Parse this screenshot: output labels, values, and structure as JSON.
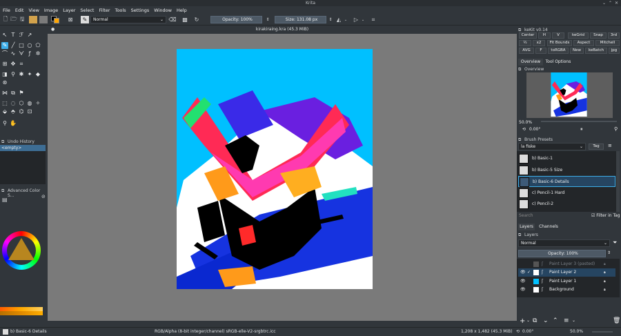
{
  "window": {
    "title": "Krita"
  },
  "menu": [
    "File",
    "Edit",
    "View",
    "Image",
    "Layer",
    "Select",
    "Filter",
    "Tools",
    "Settings",
    "Window",
    "Help"
  ],
  "toolbar": {
    "blend_mode": "Normal",
    "opacity": "Opacity: 100%",
    "size": "Size: 131.08 px"
  },
  "document": {
    "tab_title": "kirakiraing.kra (45.3 MiB)"
  },
  "left_dock": {
    "undo_history_title": "Undo History",
    "undo_item": "<empty>",
    "advanced_color_title": "Advanced Color S..."
  },
  "right_dock": {
    "kekit_title": "keKit v0.14",
    "kekit_row1": [
      "Center",
      "H",
      "V",
      "keGrid",
      "Snap",
      "3rd"
    ],
    "kekit_row2": [
      "½",
      "x2",
      "Fit Bounds",
      "Aspect",
      "Mitchell"
    ],
    "kekit_row3": [
      "AVG",
      "F",
      "toRGBA",
      "New",
      "keBatch",
      "jpg"
    ],
    "tabs": [
      "Overview",
      "Tool Options"
    ],
    "overview_title": "Overview",
    "zoom": "50.0%",
    "rotation": "0.00°",
    "brush_presets_title": "Brush Presets",
    "preset_tag": "la fiske",
    "tag_label": "Tag",
    "presets": [
      "b) Basic-1",
      "b) Basic-5 Size",
      "b) Basic-6 Details",
      "c) Pencil-1 Hard",
      "c) Pencil-2"
    ],
    "search_placeholder": "Search",
    "filter_in_tag": "Filter in Tag",
    "layer_tabs": [
      "Layers",
      "Channels"
    ],
    "layers_title": "Layers",
    "layer_blend": "Normal",
    "layer_opacity": "Opacity: 100%",
    "layers": [
      "Paint Layer 3 (pasted)",
      "Paint Layer 2",
      "Paint Layer 1",
      "Background"
    ]
  },
  "status": {
    "brush": "b) Basic-6 Details",
    "color_space": "RGB/Alpha (8-bit integer/channel)  sRGB-elle-V2-srgbtrc.icc",
    "dimensions": "1,208 x 1,482 (45.3 MiB)",
    "rotation": "0.00°",
    "zoom": "50.0%"
  },
  "colors": {
    "accent": "#3daee9",
    "fg_swatch": "#ffa500",
    "canvas_bg": "#00c0ff"
  }
}
